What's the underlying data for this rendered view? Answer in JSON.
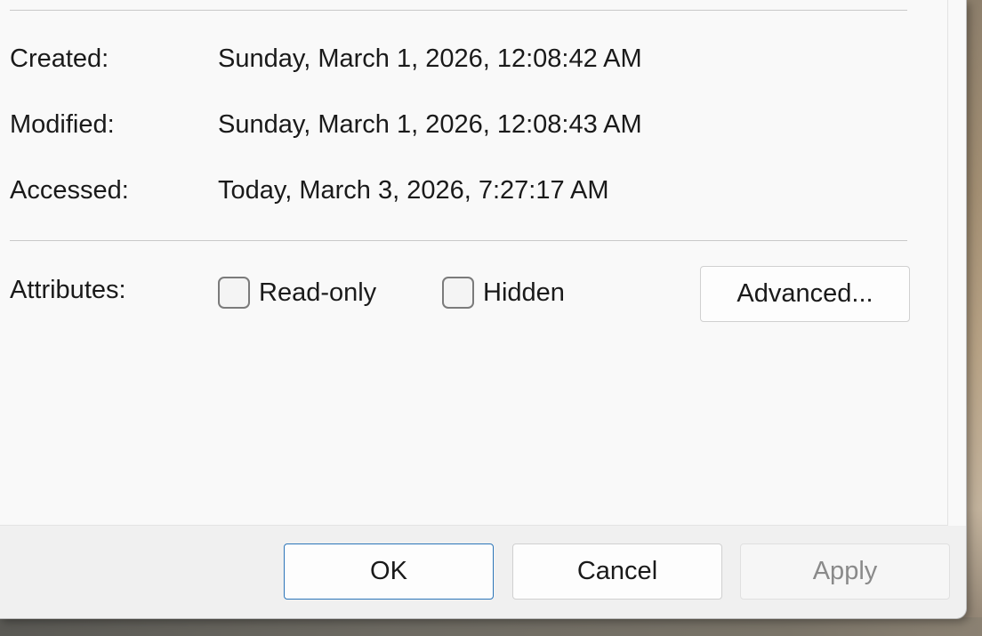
{
  "dates": {
    "created": {
      "label": "Created:",
      "value": "Sunday, March 1, 2026, 12:08:42 AM"
    },
    "modified": {
      "label": "Modified:",
      "value": "Sunday, March 1, 2026, 12:08:43 AM"
    },
    "accessed": {
      "label": "Accessed:",
      "value": "Today, March 3, 2026, 7:27:17 AM"
    }
  },
  "attributes": {
    "label": "Attributes:",
    "read_only": {
      "label": "Read-only",
      "checked": false
    },
    "hidden": {
      "label": "Hidden",
      "checked": false
    },
    "advanced_label": "Advanced..."
  },
  "footer": {
    "ok_label": "OK",
    "cancel_label": "Cancel",
    "apply_label": "Apply"
  },
  "colors": {
    "accent": "#2b74b8",
    "disabled_text": "#8a8a8a"
  }
}
